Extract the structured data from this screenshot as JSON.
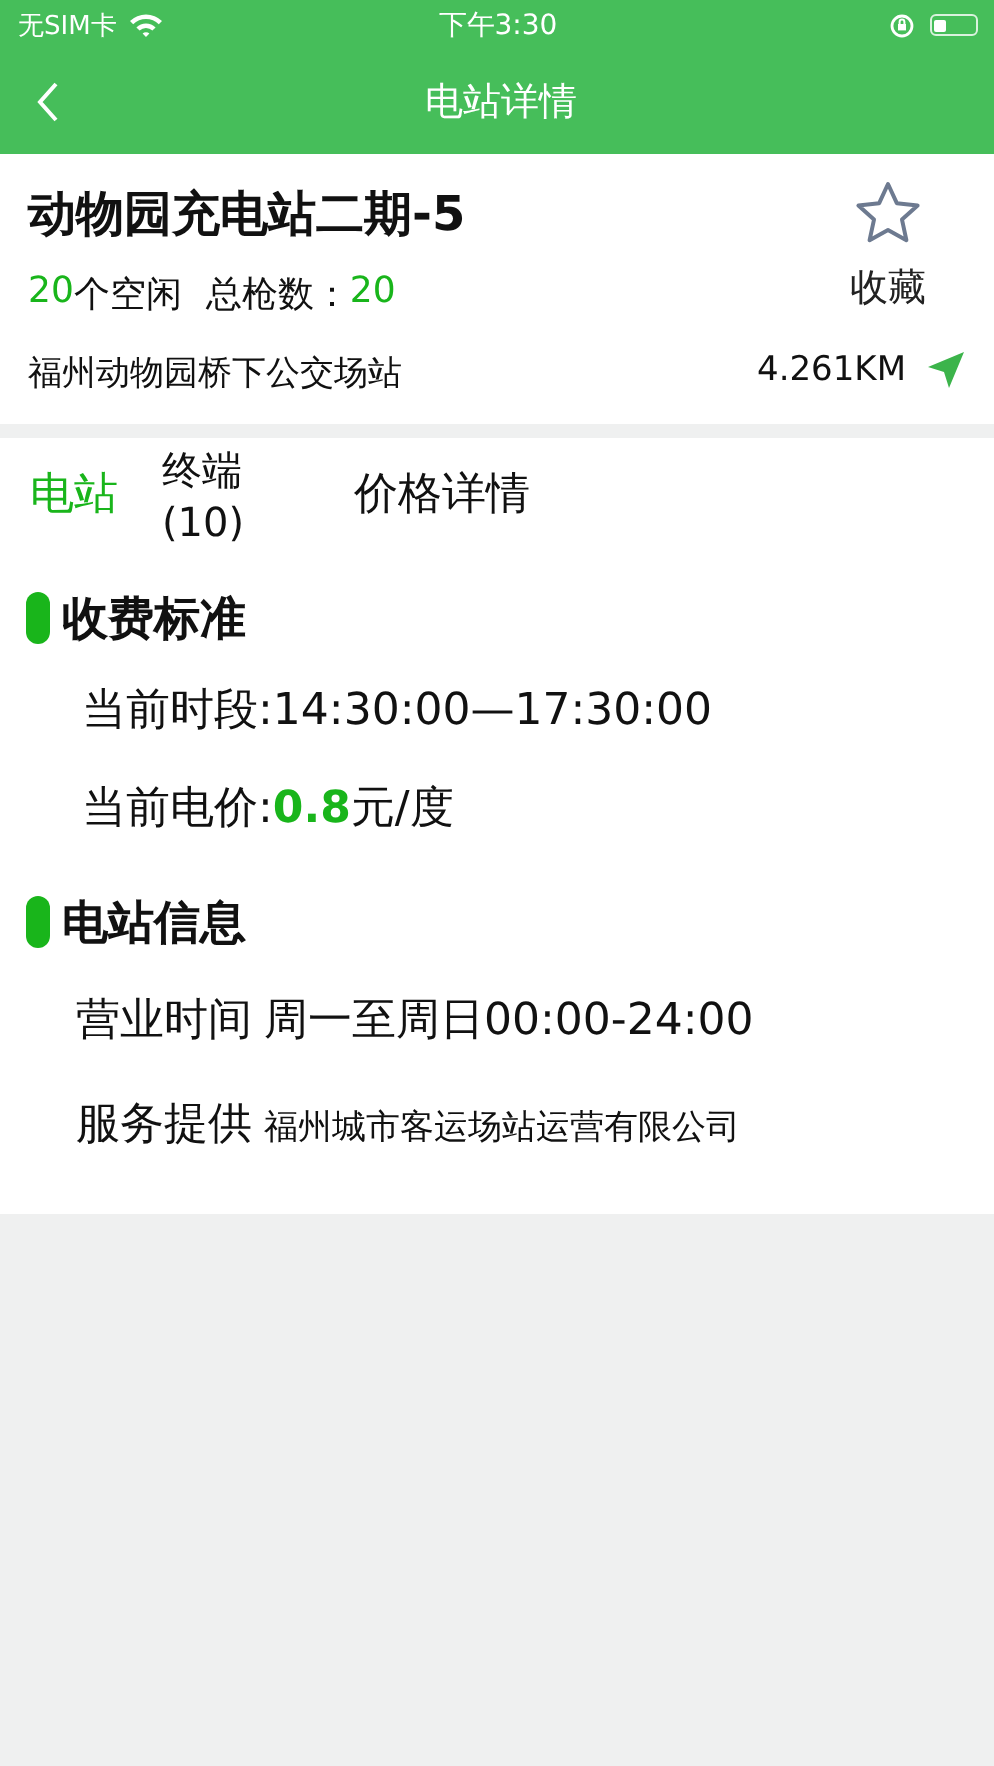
{
  "status_bar": {
    "carrier": "无SIM卡",
    "time": "下午3:30"
  },
  "nav": {
    "title": "电站详情"
  },
  "station": {
    "name": "动物园充电站二期-5",
    "free_count": "20",
    "free_label": "个空闲",
    "total_label": "总枪数：",
    "total_count": "20",
    "favorite": {
      "label": "收藏",
      "selected": false
    },
    "address": "福州动物园桥下公交场站",
    "distance": "4.261KM"
  },
  "tabs": [
    {
      "label": "电站",
      "selected": true
    },
    {
      "label": "终端(10)",
      "selected": false
    },
    {
      "label": "价格详情",
      "selected": false
    }
  ],
  "sections": [
    {
      "title": "收费标准",
      "rows": [
        {
          "kind": "plain",
          "text": "当前时段:14:30:00—17:30:00"
        },
        {
          "kind": "plain",
          "text": "当前电价:**0.8**元/度"
        }
      ]
    },
    {
      "title": "电站信息",
      "rows": [
        {
          "kind": "pair",
          "label": "营业时间",
          "value": "周一至周日00:00-24:00"
        },
        {
          "kind": "provider",
          "label": "服务提供",
          "value": "福州城市客运场站运营有限公司"
        }
      ]
    }
  ]
}
